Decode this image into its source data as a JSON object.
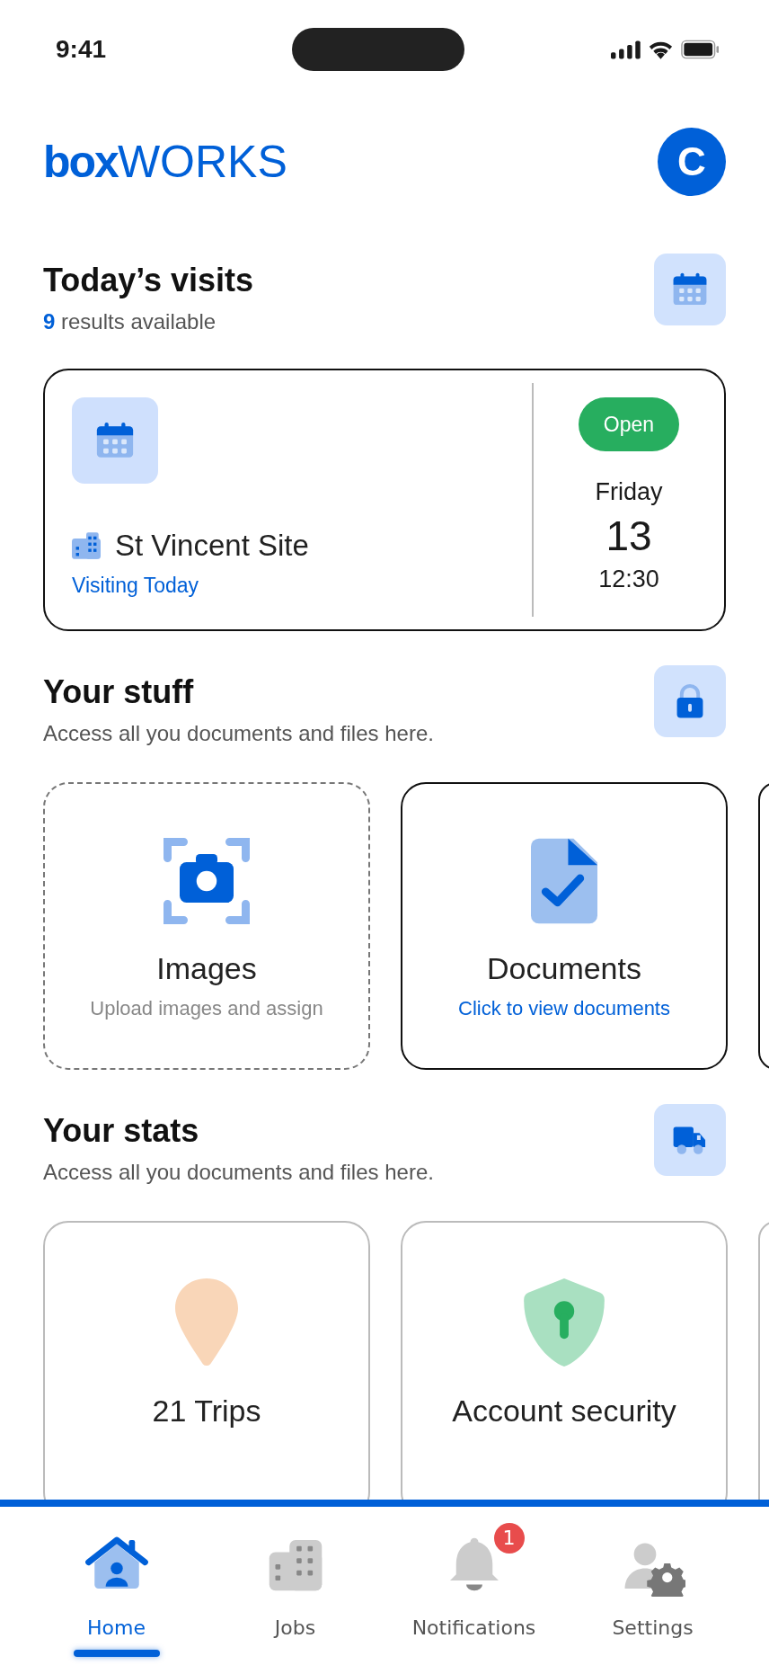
{
  "status_bar": {
    "time": "9:41"
  },
  "header": {
    "logo_bold": "box",
    "logo_light": "WORKS",
    "avatar_initial": "C"
  },
  "visits": {
    "title": "Today’s visits",
    "count": "9",
    "count_label": "results available",
    "card": {
      "site": "St Vincent Site",
      "note": "Visiting Today",
      "status": "Open",
      "day": "Friday",
      "date": "13",
      "time": "12:30"
    }
  },
  "stuff": {
    "title": "Your stuff",
    "subtitle": "Access all you documents and files here.",
    "cards": [
      {
        "kind": "upload",
        "title": "Images",
        "caption": "Upload images and assign"
      },
      {
        "kind": "link",
        "title": "Documents",
        "caption": "Click to view documents"
      }
    ]
  },
  "stats": {
    "title": "Your stats",
    "subtitle": "Access all you documents and files here.",
    "cards": [
      {
        "kind": "location",
        "title": "21 Trips"
      },
      {
        "kind": "security",
        "title": "Account security"
      }
    ]
  },
  "nav": {
    "items": [
      {
        "kind": "home",
        "label": "Home",
        "selected": true
      },
      {
        "kind": "jobs",
        "label": "Jobs",
        "selected": false
      },
      {
        "kind": "notifications",
        "label": "Notifications",
        "selected": false,
        "badge": "1"
      },
      {
        "kind": "settings",
        "label": "Settings",
        "selected": false
      }
    ]
  }
}
